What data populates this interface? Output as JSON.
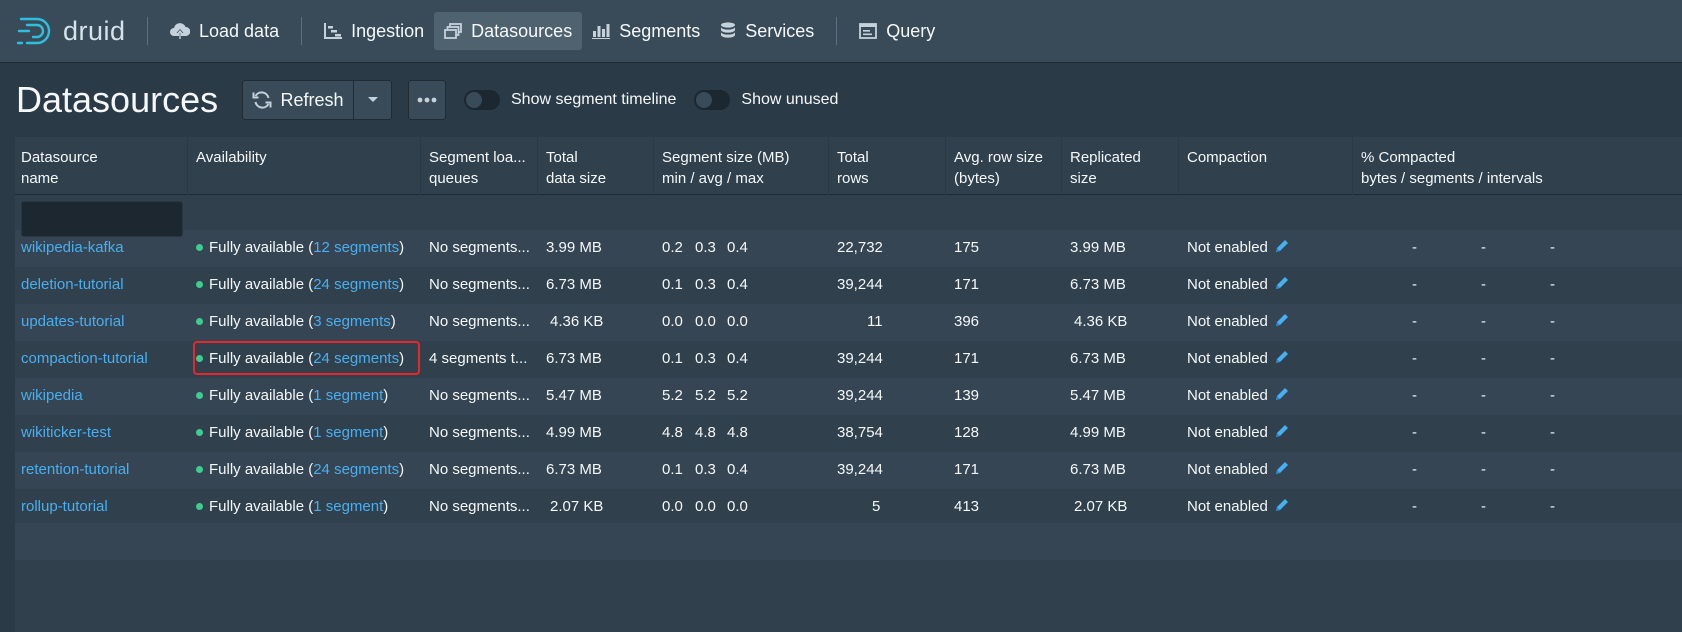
{
  "nav": {
    "brand": "druid",
    "items": [
      {
        "label": "Load data"
      },
      {
        "label": "Ingestion"
      },
      {
        "label": "Datasources"
      },
      {
        "label": "Segments"
      },
      {
        "label": "Services"
      },
      {
        "label": "Query"
      }
    ],
    "active": "Datasources"
  },
  "page": {
    "title": "Datasources",
    "refresh_label": "Refresh",
    "toggle_timeline_label": "Show segment timeline",
    "toggle_unused_label": "Show unused"
  },
  "table": {
    "columns": [
      {
        "line1": "Datasource",
        "line2": "name"
      },
      {
        "line1": "Availability",
        "line2": ""
      },
      {
        "line1": "Segment loa...",
        "line2": "queues"
      },
      {
        "line1": "Total",
        "line2": "data size"
      },
      {
        "line1": "Segment size (MB)",
        "line2": "min / avg / max"
      },
      {
        "line1": "Total",
        "line2": "rows"
      },
      {
        "line1": "Avg. row size",
        "line2": "(bytes)"
      },
      {
        "line1": "Replicated",
        "line2": "size"
      },
      {
        "line1": "Compaction",
        "line2": ""
      },
      {
        "line1": "% Compacted",
        "line2": "bytes / segments / intervals"
      }
    ],
    "rows": [
      {
        "name": "wikipedia-kafka",
        "avail_prefix": "Fully available (",
        "avail_link": "12 segments",
        "avail_suffix": ")",
        "queue": "No segments...",
        "size": "3.99 MB",
        "seg_min": "0.2",
        "seg_avg": "0.3",
        "seg_max": "0.4",
        "rows": "22,732",
        "avg_row": "175",
        "replicated": "3.99 MB",
        "compaction": "Not enabled",
        "pc_bytes": "-",
        "pc_segments": "-",
        "pc_intervals": "-"
      },
      {
        "name": "deletion-tutorial",
        "avail_prefix": "Fully available (",
        "avail_link": "24 segments",
        "avail_suffix": ")",
        "queue": "No segments...",
        "size": "6.73 MB",
        "seg_min": "0.1",
        "seg_avg": "0.3",
        "seg_max": "0.4",
        "rows": "39,244",
        "avg_row": "171",
        "replicated": "6.73 MB",
        "compaction": "Not enabled",
        "pc_bytes": "-",
        "pc_segments": "-",
        "pc_intervals": "-"
      },
      {
        "name": "updates-tutorial",
        "avail_prefix": "Fully available (",
        "avail_link": "3 segments",
        "avail_suffix": ")",
        "queue": "No segments...",
        "size": "4.36 KB",
        "seg_min": "0.0",
        "seg_avg": "0.0",
        "seg_max": "0.0",
        "rows": "11",
        "avg_row": "396",
        "replicated": "4.36 KB",
        "compaction": "Not enabled",
        "pc_bytes": "-",
        "pc_segments": "-",
        "pc_intervals": "-"
      },
      {
        "name": "compaction-tutorial",
        "avail_prefix": "Fully available (",
        "avail_link": "24 segments",
        "avail_suffix": ")",
        "queue": "4 segments t...",
        "size": "6.73 MB",
        "seg_min": "0.1",
        "seg_avg": "0.3",
        "seg_max": "0.4",
        "rows": "39,244",
        "avg_row": "171",
        "replicated": "6.73 MB",
        "compaction": "Not enabled",
        "pc_bytes": "-",
        "pc_segments": "-",
        "pc_intervals": "-"
      },
      {
        "name": "wikipedia",
        "avail_prefix": "Fully available (",
        "avail_link": "1 segment",
        "avail_suffix": ")",
        "queue": "No segments...",
        "size": "5.47 MB",
        "seg_min": "5.2",
        "seg_avg": "5.2",
        "seg_max": "5.2",
        "rows": "39,244",
        "avg_row": "139",
        "replicated": "5.47 MB",
        "compaction": "Not enabled",
        "pc_bytes": "-",
        "pc_segments": "-",
        "pc_intervals": "-"
      },
      {
        "name": "wikiticker-test",
        "avail_prefix": "Fully available (",
        "avail_link": "1 segment",
        "avail_suffix": ")",
        "queue": "No segments...",
        "size": "4.99 MB",
        "seg_min": "4.8",
        "seg_avg": "4.8",
        "seg_max": "4.8",
        "rows": "38,754",
        "avg_row": "128",
        "replicated": "4.99 MB",
        "compaction": "Not enabled",
        "pc_bytes": "-",
        "pc_segments": "-",
        "pc_intervals": "-"
      },
      {
        "name": "retention-tutorial",
        "avail_prefix": "Fully available (",
        "avail_link": "24 segments",
        "avail_suffix": ")",
        "queue": "No segments...",
        "size": "6.73 MB",
        "seg_min": "0.1",
        "seg_avg": "0.3",
        "seg_max": "0.4",
        "rows": "39,244",
        "avg_row": "171",
        "replicated": "6.73 MB",
        "compaction": "Not enabled",
        "pc_bytes": "-",
        "pc_segments": "-",
        "pc_intervals": "-"
      },
      {
        "name": "rollup-tutorial",
        "avail_prefix": "Fully available (",
        "avail_link": "1 segment",
        "avail_suffix": ")",
        "queue": "No segments...",
        "size": "2.07 KB",
        "seg_min": "0.0",
        "seg_avg": "0.0",
        "seg_max": "0.0",
        "rows": "5",
        "avg_row": "413",
        "replicated": "2.07 KB",
        "compaction": "Not enabled",
        "pc_bytes": "-",
        "pc_segments": "-",
        "pc_intervals": "-"
      }
    ]
  },
  "colors": {
    "accent_link": "#48aff0",
    "available_dot": "#3dcc91",
    "highlight_box": "#e8262c"
  }
}
